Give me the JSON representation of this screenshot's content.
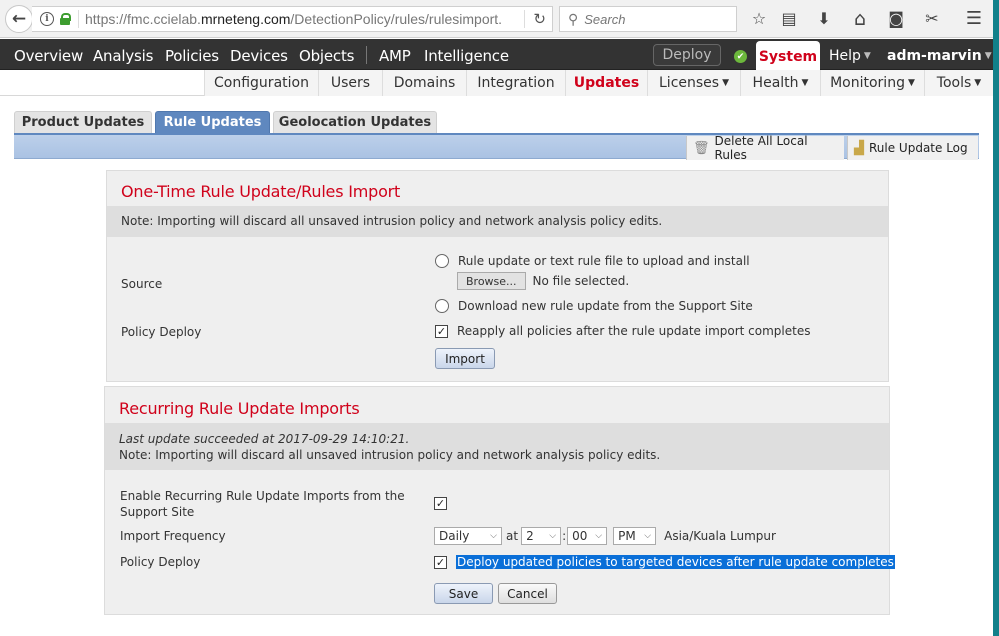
{
  "browser": {
    "url_prefix": "https://fmc.ccielab.",
    "url_domain": "mrneteng.com",
    "url_suffix": "/DetectionPolicy/rules/rulesimport.",
    "search_placeholder": "Search",
    "icons": {
      "back": "←",
      "info": "i",
      "reload": "↻",
      "search": "⚲",
      "bookmark_star": "☆",
      "reader": "▤",
      "download": "⬇",
      "home": "⌂",
      "pocket": "◙",
      "extension": "✂",
      "menu": "☰"
    }
  },
  "topnav": {
    "items": [
      "Overview",
      "Analysis",
      "Policies",
      "Devices",
      "Objects",
      "AMP",
      "Intelligence"
    ],
    "deploy_label": "Deploy",
    "status_icon": "✔",
    "system_label": "System",
    "help_label": "Help",
    "user_label": "adm-marvin",
    "caret": "▼"
  },
  "subnav": {
    "items": [
      {
        "label": "Configuration",
        "dropdown": false
      },
      {
        "label": "Users",
        "dropdown": false
      },
      {
        "label": "Domains",
        "dropdown": false
      },
      {
        "label": "Integration",
        "dropdown": false
      },
      {
        "label": "Updates",
        "dropdown": false,
        "active": true
      },
      {
        "label": "Licenses",
        "dropdown": true
      },
      {
        "label": "Health",
        "dropdown": true
      },
      {
        "label": "Monitoring",
        "dropdown": true
      },
      {
        "label": "Tools",
        "dropdown": true
      }
    ]
  },
  "tabs": [
    {
      "label": "Product Updates"
    },
    {
      "label": "Rule Updates",
      "active": true
    },
    {
      "label": "Geolocation Updates"
    }
  ],
  "toolbar": {
    "delete_label": "Delete All Local Rules",
    "delete_icon": "🗑",
    "log_label": "Rule Update Log",
    "log_icon": "▟"
  },
  "one_time": {
    "title": "One-Time Rule Update/Rules Import",
    "note": "Note: Importing will discard all unsaved intrusion policy and network analysis policy edits.",
    "source_label": "Source",
    "option_upload": "Rule update or text rule file to upload and install",
    "browse_label": "Browse...",
    "no_file": "No file selected.",
    "option_download": "Download new rule update from the Support Site",
    "policy_deploy_label": "Policy Deploy",
    "reapply_label": "Reapply all policies after the rule update import completes",
    "reapply_checked": true,
    "import_label": "Import"
  },
  "recurring": {
    "title": "Recurring Rule Update Imports",
    "last_update": "Last update succeeded at 2017-09-29 14:10:21.",
    "note": "Note: Importing will discard all unsaved intrusion policy and network analysis policy edits.",
    "enable_label_line1": "Enable Recurring Rule Update Imports from the",
    "enable_label_line2": "Support Site",
    "enable_checked": true,
    "frequency_label": "Import Frequency",
    "frequency": "Daily",
    "at_label": "at",
    "hour": "2",
    "colon": ":",
    "minute": "00",
    "ampm": "PM",
    "timezone": "Asia/Kuala Lumpur",
    "policy_deploy_label": "Policy Deploy",
    "deploy_text": "Deploy updated policies to targeted devices after rule update completes",
    "deploy_checked": true,
    "save_label": "Save",
    "cancel_label": "Cancel",
    "check_glyph": "✓",
    "chevron": "⌵"
  }
}
